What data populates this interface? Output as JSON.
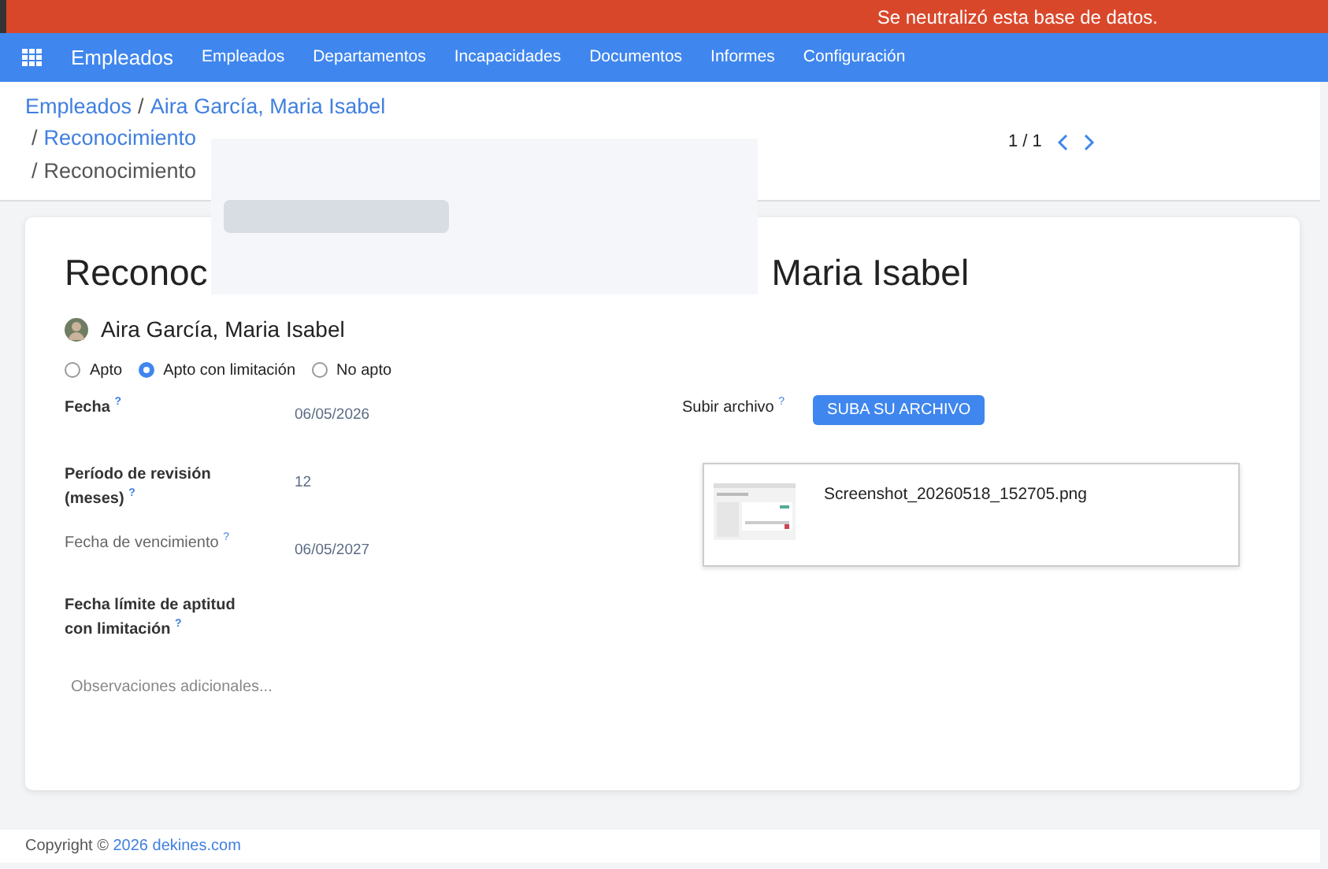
{
  "banner": {
    "text": "Se neutralizó esta base de datos."
  },
  "navbar": {
    "app": "Empleados",
    "menu": [
      "Empleados",
      "Departamentos",
      "Incapacidades",
      "Documentos",
      "Informes",
      "Configuración"
    ]
  },
  "breadcrumb": {
    "separators": [
      "/",
      "/",
      "/"
    ],
    "links": [
      "Empleados",
      "Aira García, Maria Isabel"
    ],
    "second_line": "Reconocimiento",
    "current": "Reconocimiento"
  },
  "pager": {
    "text": "1 / 1"
  },
  "form": {
    "title_start": "Reconoc",
    "title_end": "Maria Isabel",
    "employee": "Aira García, Maria Isabel",
    "aptitude": [
      {
        "label": "Apto",
        "selected": false
      },
      {
        "label": "Apto con limitación",
        "selected": true
      },
      {
        "label": "No apto",
        "selected": false
      }
    ],
    "fields": [
      {
        "label": "Fecha",
        "value": "06/05/2026",
        "muted": false
      },
      {
        "label": "Período de revisión (meses)",
        "value": "12",
        "muted": false
      },
      {
        "label": "Fecha de vencimiento",
        "value": "06/05/2027",
        "muted": true
      },
      {
        "label": "Fecha límite de aptitud con limitación",
        "muted": false
      }
    ],
    "help_mark": "?",
    "notes_placeholder": "Observaciones adicionales...",
    "upload": {
      "label": "Subir archivo",
      "button": "SUBA SU ARCHIVO",
      "file": "Screenshot_20260518_152705.png"
    }
  },
  "footer": {
    "text": "Copyright ©",
    "link": "2026 dekines.com"
  }
}
